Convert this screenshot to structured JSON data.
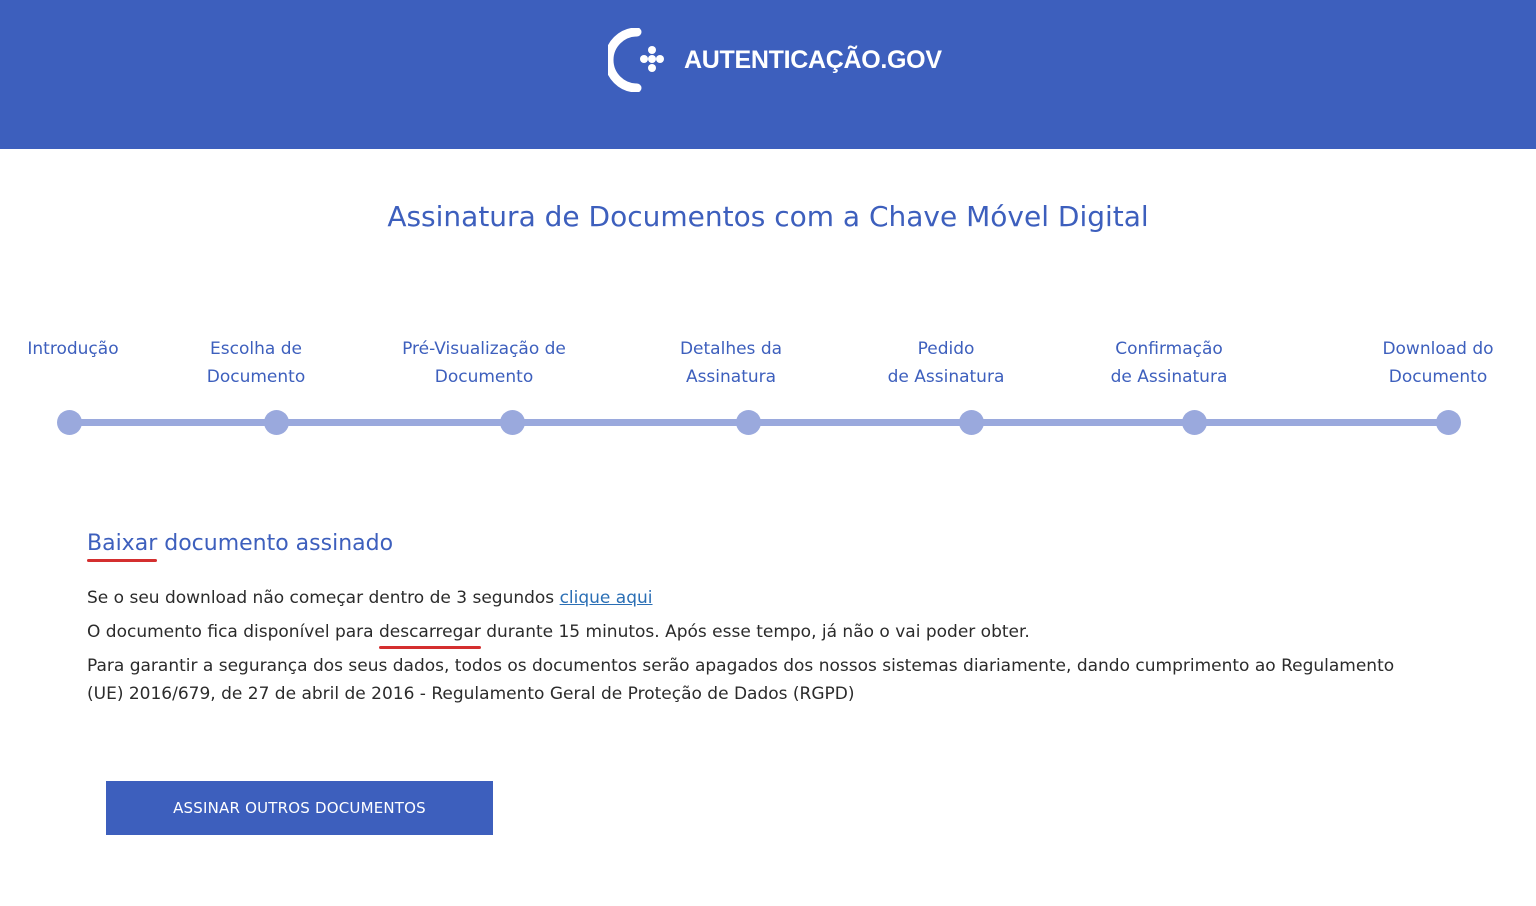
{
  "header": {
    "brand_text": "AUTENTICAÇÃO.GOV",
    "logo_icon": "autenticacao-gov-logo-icon",
    "background_color": "#3d5fbd"
  },
  "page_title": "Assinatura de Documentos com a Chave Móvel Digital",
  "steps": [
    {
      "label": "Introdução"
    },
    {
      "label": "Escolha de\nDocumento"
    },
    {
      "label": "Pré-Visualização de\nDocumento"
    },
    {
      "label": "Detalhes da\nAssinatura"
    },
    {
      "label": "Pedido\nde Assinatura"
    },
    {
      "label": "Confirmação\nde Assinatura"
    },
    {
      "label": "Download do\nDocumento"
    }
  ],
  "download_section": {
    "title_underlined": "Baixar",
    "title_rest": " documento assinado",
    "line1_text": "Se o seu download não começar dentro de 3 segundos ",
    "line1_link": "clique aqui",
    "line2_before": "O documento fica disponível para ",
    "line2_underlined": "descarregar",
    "line2_after": " durante 15 minutos. Após esse tempo, já não o vai poder obter.",
    "line3_text": "Para garantir a segurança dos seus dados, todos os documentos serão apagados dos nossos sistemas diariamente, dando cumprimento ao Regulamento (UE) 2016/679, de 27 de abril de 2016 - Regulamento Geral de Proteção de Dados (RGPD)"
  },
  "actions": {
    "sign_other_label": "ASSINAR OUTROS DOCUMENTOS"
  },
  "colors": {
    "accent": "#3d5fbd",
    "stepper": "#9aa9dd",
    "link": "#2b6fb5",
    "spellcheck_underline": "#d42f2f"
  }
}
